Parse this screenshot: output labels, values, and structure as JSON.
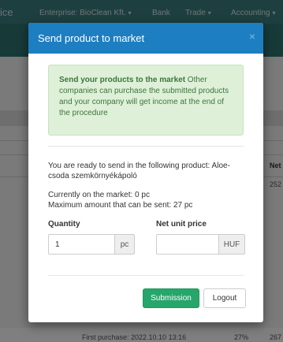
{
  "background": {
    "brand_fragment": "ice",
    "nav": [
      {
        "label": "Enterprise: BioClean Kft."
      },
      {
        "label": "Bank"
      },
      {
        "label": "Trade"
      },
      {
        "label": "Accounting"
      }
    ],
    "table_header_fragment": "Net",
    "cell_fragment_top": "252",
    "row_text": "First purchase: 2022.10.10 13:16",
    "row_percent": "27%",
    "row_value_fragment": "267"
  },
  "modal": {
    "title": "Send product to market",
    "close_glyph": "×",
    "alert": {
      "bold": "Send your products to the market",
      "text": " Other companies can purchase the submitted products and your company will get income at the end of the procedure"
    },
    "ready_text": "You are ready to send in the following product: Aloe-csoda szemkörnyékápoló",
    "on_market_text": "Currently on the market: 0 pc",
    "max_text": "Maximum amount that can be sent: 27 pc",
    "quantity": {
      "label": "Quantity",
      "value": "1",
      "unit": "pc"
    },
    "price": {
      "label": "Net unit price",
      "value": "",
      "unit": "HUF"
    },
    "buttons": {
      "submit": "Submission",
      "logout": "Logout"
    }
  },
  "colors": {
    "header": "#1d7ec2",
    "primary_button": "#27a66b",
    "alert_bg": "#dff0d8",
    "alert_text": "#3c763d"
  }
}
